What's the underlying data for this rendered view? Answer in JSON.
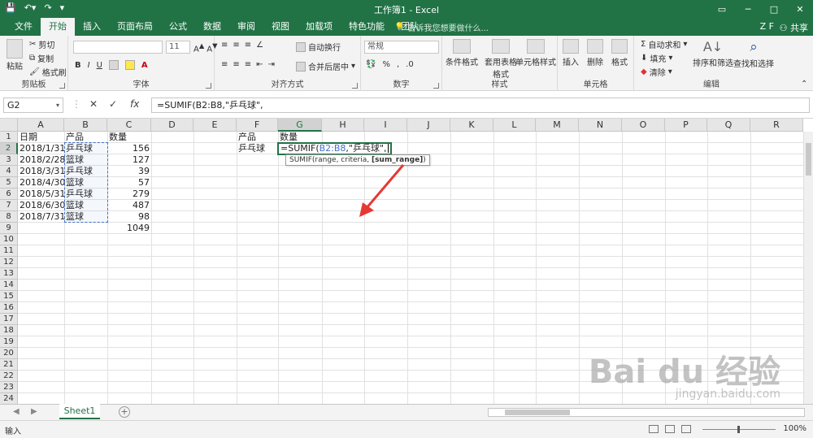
{
  "window": {
    "title": "工作簿1 - Excel",
    "controls": [
      "─",
      "▭",
      "□",
      "✕"
    ]
  },
  "tabs": [
    "文件",
    "开始",
    "插入",
    "页面布局",
    "公式",
    "数据",
    "审阅",
    "视图",
    "加载项",
    "特色功能",
    "团队"
  ],
  "active_tab": "开始",
  "tellme": "告诉我您想要做什么...",
  "user": "Z F",
  "share": "共享",
  "ribbon": {
    "clipboard": {
      "label": "剪贴板",
      "paste": "粘贴",
      "cut": "剪切",
      "copy": "复制",
      "format_painter": "格式刷"
    },
    "font": {
      "label": "字体",
      "font_size": "11"
    },
    "alignment": {
      "label": "对齐方式",
      "wrap": "自动换行",
      "merge": "合并后居中"
    },
    "number": {
      "label": "数字",
      "format": "常规",
      "percent": "%",
      "comma": ","
    },
    "styles": {
      "label": "样式",
      "conditional": "条件格式",
      "table": "套用表格格式",
      "cell_styles": "单元格样式"
    },
    "cells": {
      "label": "单元格",
      "insert": "插入",
      "delete": "删除",
      "format": "格式"
    },
    "editing": {
      "label": "编辑",
      "autosum": "自动求和",
      "fill": "填充",
      "clear": "清除",
      "sort": "排序和筛选",
      "find": "查找和选择"
    }
  },
  "formula_bar": {
    "name_box": "G2",
    "cancel": "✕",
    "enter": "✓",
    "fx": "fx",
    "formula": "=SUMIF(B2:B8,\"乒乓球\","
  },
  "columns": [
    "A",
    "B",
    "C",
    "D",
    "E",
    "F",
    "G",
    "H",
    "I",
    "J",
    "K",
    "L",
    "M",
    "N",
    "O",
    "P",
    "Q",
    "R"
  ],
  "rows": [
    "1",
    "2",
    "3",
    "4",
    "5",
    "6",
    "7",
    "8",
    "9",
    "10",
    "11",
    "12",
    "13",
    "14",
    "15",
    "16",
    "17",
    "18",
    "19",
    "20",
    "21",
    "22",
    "23",
    "24"
  ],
  "headers": {
    "date": "日期",
    "product": "产品",
    "qty": "数量"
  },
  "table": [
    {
      "date": "2018/1/31",
      "product": "乒乓球",
      "qty": "156"
    },
    {
      "date": "2018/2/28",
      "product": "篮球",
      "qty": "127"
    },
    {
      "date": "2018/3/31",
      "product": "乒乓球",
      "qty": "39"
    },
    {
      "date": "2018/4/30",
      "product": "篮球",
      "qty": "57"
    },
    {
      "date": "2018/5/31",
      "product": "乒乓球",
      "qty": "279"
    },
    {
      "date": "2018/6/30",
      "product": "篮球",
      "qty": "487"
    },
    {
      "date": "2018/7/31",
      "product": "篮球",
      "qty": "98"
    }
  ],
  "total": "1049",
  "criteria_block": {
    "product_header": "产品",
    "qty_header": "数量",
    "product_value": "乒乓球"
  },
  "edit_cell": {
    "prefix": "=SUMIF(",
    "ref": "B2:B8",
    "suffix": ",\"乒乓球\","
  },
  "tooltip": {
    "text": "SUMIF(range, criteria, ",
    "bold": "[sum_range]",
    "end": ")"
  },
  "sheet_tab": "Sheet1",
  "status": "输入",
  "zoom": "100%",
  "watermark": {
    "main": "Bai du 经验",
    "sub": "jingyan.baidu.com"
  },
  "colors": {
    "excel_green": "#217346",
    "ref_blue": "#4472c4",
    "arrow_red": "#e53935"
  }
}
